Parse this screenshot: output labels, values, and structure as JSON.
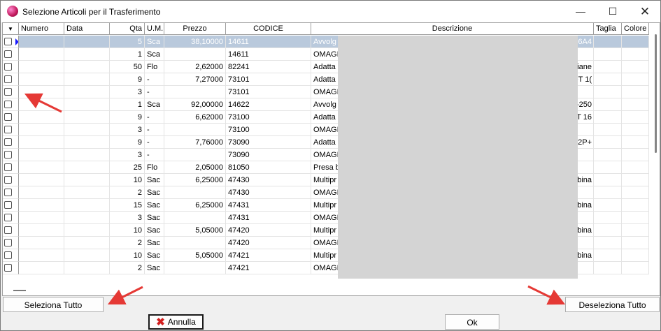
{
  "window": {
    "title": "Selezione Articoli per il Trasferimento",
    "controls": {
      "minimize": "—",
      "maximize": "☐",
      "close": "✕"
    }
  },
  "grid": {
    "header_sort_icon": "▼",
    "columns": [
      "Numero",
      "Data",
      "Qta",
      "U.M.",
      "Prezzo",
      "CODICE",
      "Descrizione",
      "Taglia",
      "Colore"
    ],
    "rows": [
      {
        "qta": "5",
        "um": "Sca",
        "prezzo": "38,10000",
        "codice": "14611",
        "desc_left": "Avvolg",
        "desc_right": "6A4",
        "selected": true
      },
      {
        "qta": "1",
        "um": "Sca",
        "prezzo": "",
        "codice": "14611",
        "desc_left": "OMAGI",
        "desc_right": ""
      },
      {
        "qta": "50",
        "um": "Flo",
        "prezzo": "2,62000",
        "codice": "82241",
        "desc_left": "Adatta",
        "desc_right": "liane"
      },
      {
        "qta": "9",
        "um": "-",
        "prezzo": "7,27000",
        "codice": "73101",
        "desc_left": "Adatta",
        "desc_right": "+T 1("
      },
      {
        "qta": "3",
        "um": "-",
        "prezzo": "",
        "codice": "73101",
        "desc_left": "OMAGI",
        "desc_right": ""
      },
      {
        "qta": "1",
        "um": "Sca",
        "prezzo": "92,00000",
        "codice": "14622",
        "desc_left": "Avvolg",
        "desc_right": "-250"
      },
      {
        "qta": "9",
        "um": "-",
        "prezzo": "6,62000",
        "codice": "73100",
        "desc_left": "Adatta",
        "desc_right": "T 16"
      },
      {
        "qta": "3",
        "um": "-",
        "prezzo": "",
        "codice": "73100",
        "desc_left": "OMAGI",
        "desc_right": ""
      },
      {
        "qta": "9",
        "um": "-",
        "prezzo": "7,76000",
        "codice": "73090",
        "desc_left": "Adatta",
        "desc_right": "2P+"
      },
      {
        "qta": "3",
        "um": "-",
        "prezzo": "",
        "codice": "73090",
        "desc_left": "OMAGI",
        "desc_right": ""
      },
      {
        "qta": "25",
        "um": "Flo",
        "prezzo": "2,05000",
        "codice": "81050",
        "desc_left": "Presa b",
        "desc_right": ""
      },
      {
        "qta": "10",
        "um": "Sac",
        "prezzo": "6,25000",
        "codice": "47430",
        "desc_left": "Multipr",
        "desc_right": "bina"
      },
      {
        "qta": "2",
        "um": "Sac",
        "prezzo": "",
        "codice": "47430",
        "desc_left": "OMAGI",
        "desc_right": ""
      },
      {
        "qta": "15",
        "um": "Sac",
        "prezzo": "6,25000",
        "codice": "47431",
        "desc_left": "Multipr",
        "desc_right": "bina"
      },
      {
        "qta": "3",
        "um": "Sac",
        "prezzo": "",
        "codice": "47431",
        "desc_left": "OMAGI",
        "desc_right": ""
      },
      {
        "qta": "10",
        "um": "Sac",
        "prezzo": "5,05000",
        "codice": "47420",
        "desc_left": "Multipr",
        "desc_right": "bina"
      },
      {
        "qta": "2",
        "um": "Sac",
        "prezzo": "",
        "codice": "47420",
        "desc_left": "OMAGI",
        "desc_right": ""
      },
      {
        "qta": "10",
        "um": "Sac",
        "prezzo": "5,05000",
        "codice": "47421",
        "desc_left": "Multipr",
        "desc_right": "bina"
      },
      {
        "qta": "2",
        "um": "Sac",
        "prezzo": "",
        "codice": "47421",
        "desc_left": "OMAGI",
        "desc_right": ""
      }
    ]
  },
  "buttons": {
    "select_all": "Seleziona Tutto",
    "deselect_all": "Deseleziona Tutto",
    "cancel": "Annulla",
    "ok": "Ok"
  },
  "colors": {
    "annotation_arrow": "#e53935",
    "selected_row": "#b9c9dc"
  }
}
